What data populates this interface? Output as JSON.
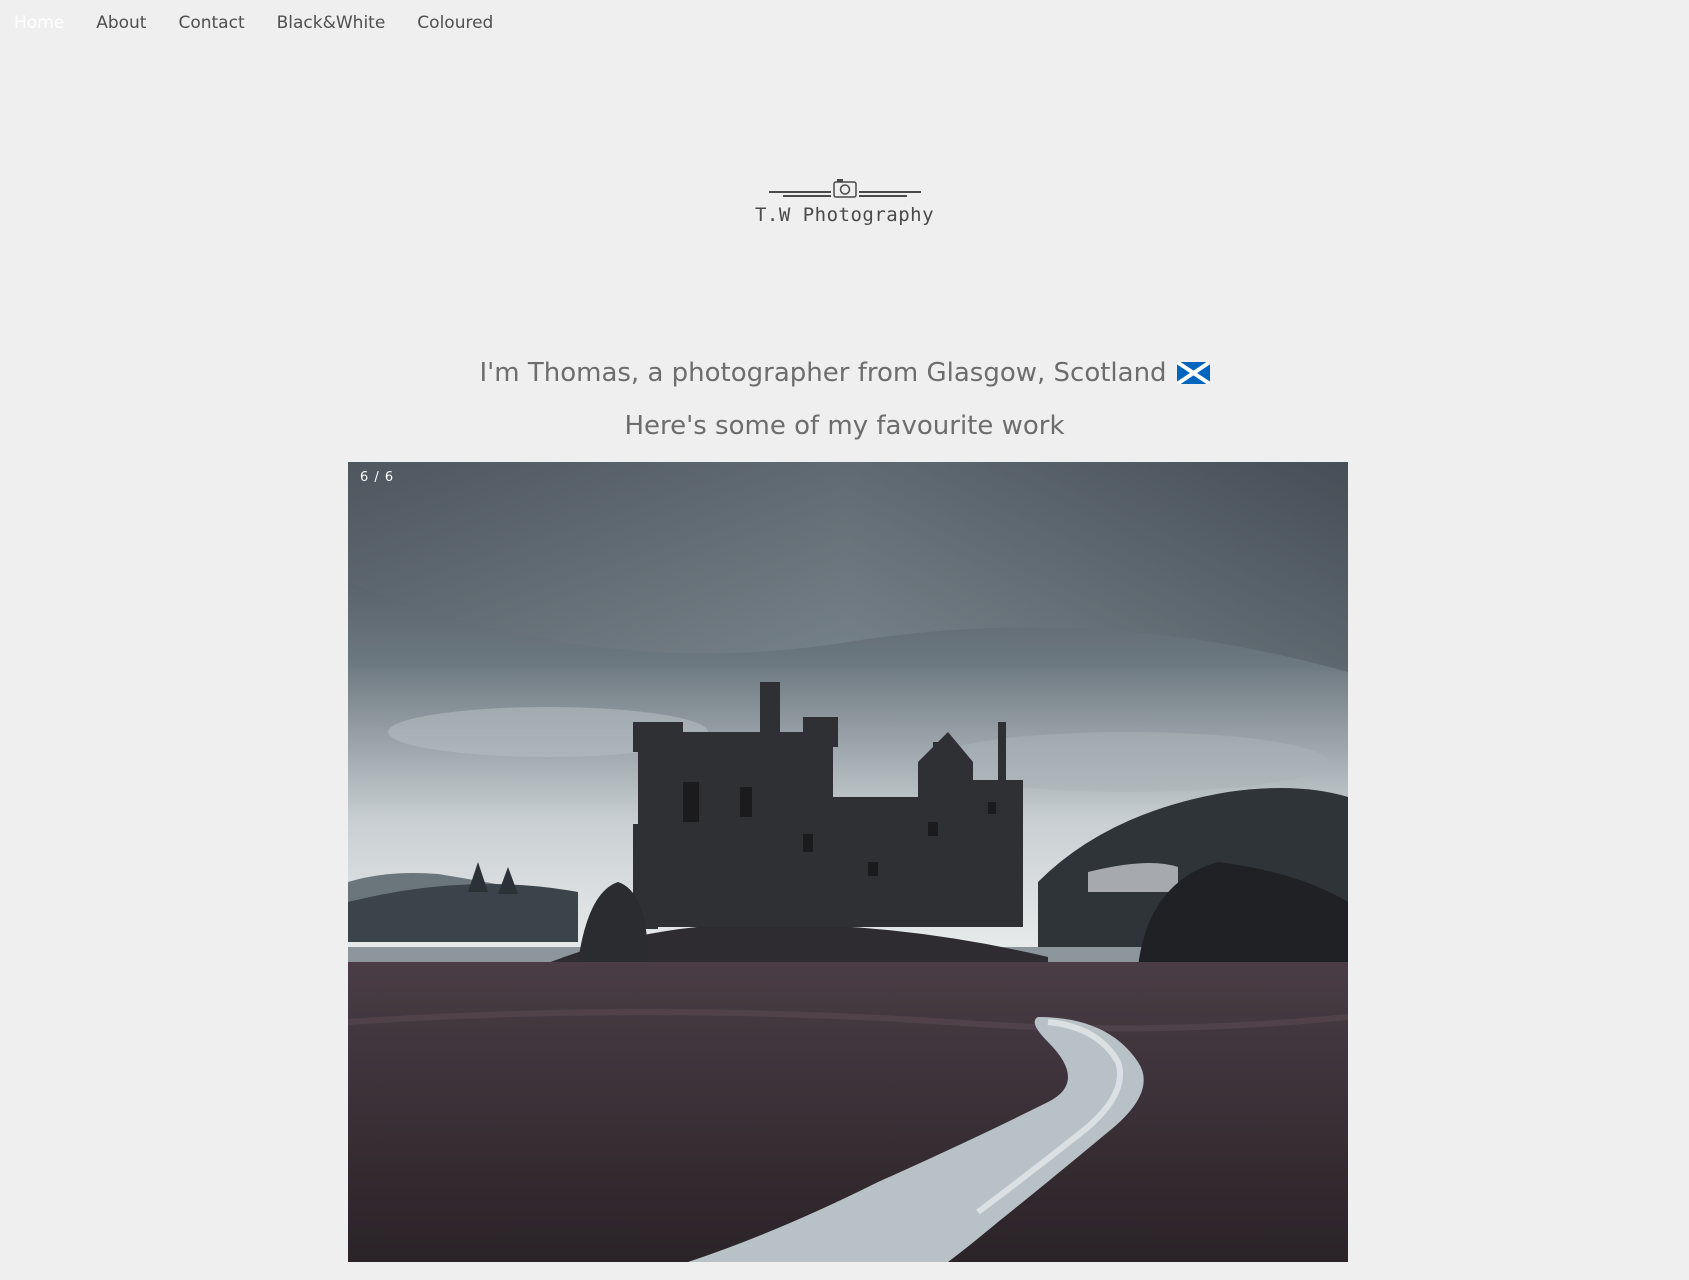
{
  "nav": {
    "items": [
      {
        "label": "Home",
        "active": true
      },
      {
        "label": "About",
        "active": false
      },
      {
        "label": "Contact",
        "active": false
      },
      {
        "label": "Black&White",
        "active": false
      },
      {
        "label": "Coloured",
        "active": false
      }
    ]
  },
  "logo": {
    "icon": "camera-icon",
    "text": "T.W Photography"
  },
  "intro": {
    "text": "I'm Thomas, a photographer from Glasgow, Scotland",
    "flag_icon": "scotland-flag-icon",
    "subtext": "Here's some of my favourite work"
  },
  "slideshow": {
    "counter": "6 / 6",
    "current": 6,
    "total": 6,
    "image_subject": "castle ruin beside loch with winding path"
  },
  "colors": {
    "background": "#efefef",
    "text": "#6d6d6d",
    "nav_text": "#4f4f4f",
    "nav_active": "#ffffff",
    "flag_blue": "#0065bd"
  }
}
